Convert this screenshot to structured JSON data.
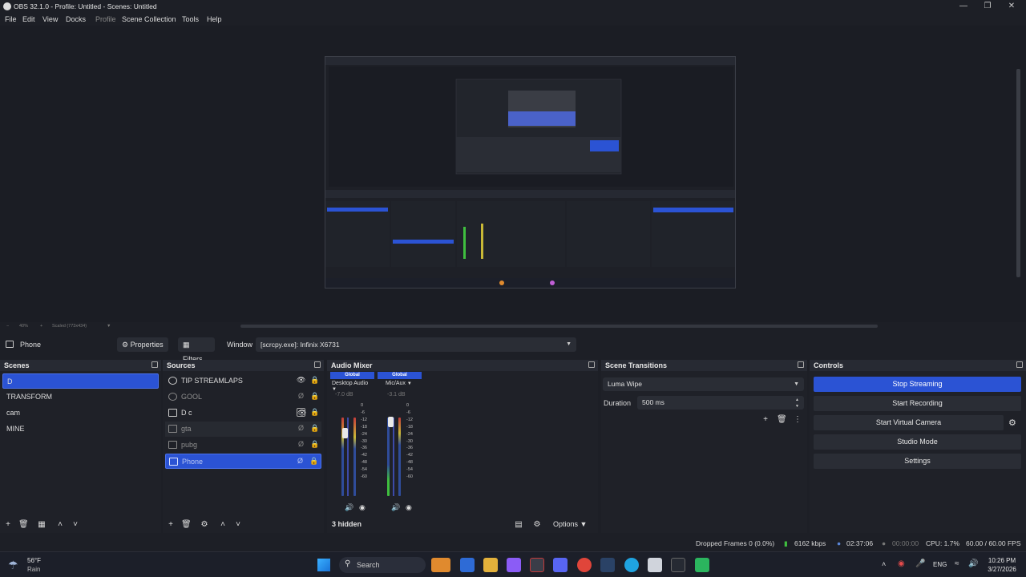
{
  "window": {
    "title": "OBS 32.1.0 - Profile: Untitled - Scenes: Untitled",
    "controls": [
      "minimize",
      "restore",
      "close"
    ]
  },
  "menu": {
    "file": "File",
    "edit": "Edit",
    "view": "View",
    "docks": "Docks",
    "profile": "Profile",
    "scene_collection": "Scene Collection",
    "tools": "Tools",
    "help": "Help"
  },
  "preview": {
    "zoom": "40%",
    "scaled": "Scaled (773x434)"
  },
  "context_bar": {
    "source_name": "Phone",
    "properties_label": "Properties",
    "filters_label": "Filters",
    "window_label": "Window",
    "window_value": "[scrcpy.exe]: Infinix X6731"
  },
  "scenes": {
    "title": "Scenes",
    "items": [
      "D",
      "TRANSFORM",
      "cam",
      "MINE"
    ],
    "selected": "D"
  },
  "sources": {
    "title": "Sources",
    "items": [
      {
        "name": "TIP STREAMLAPS",
        "icon": "browser-icon",
        "visible": true
      },
      {
        "name": "GOOL",
        "icon": "browser-icon",
        "visible": false
      },
      {
        "name": "D c",
        "icon": "window-icon",
        "visible": true
      },
      {
        "name": "gta",
        "icon": "window-icon",
        "visible": false
      },
      {
        "name": "pubg",
        "icon": "window-icon",
        "visible": false
      },
      {
        "name": "Phone",
        "icon": "window-icon",
        "visible": false,
        "selected": true
      }
    ]
  },
  "audio_mixer": {
    "title": "Audio Mixer",
    "channels": [
      {
        "global": "Global",
        "name": "Desktop Audio",
        "db": "-7.0 dB"
      },
      {
        "global": "Global",
        "name": "Mic/Aux",
        "db": "-3.1 dB"
      }
    ],
    "scale": [
      "0",
      "-6",
      "-12",
      "-18",
      "-24",
      "-30",
      "-36",
      "-42",
      "-48",
      "-54",
      "-60"
    ],
    "hidden": "3 hidden",
    "options": "Options"
  },
  "scene_transitions": {
    "title": "Scene Transitions",
    "transition": "Luma Wipe",
    "duration_label": "Duration",
    "duration_value": "500 ms"
  },
  "controls": {
    "title": "Controls",
    "stop_streaming": "Stop Streaming",
    "start_recording": "Start Recording",
    "start_virtual_camera": "Start Virtual Camera",
    "studio_mode": "Studio Mode",
    "settings": "Settings"
  },
  "status": {
    "dropped_frames": "Dropped Frames 0 (0.0%)",
    "bitrate": "6162 kbps",
    "stream_time": "02:37:06",
    "rec_time": "00:00:00",
    "cpu": "CPU: 1.7%",
    "fps": "60.00 / 60.00 FPS"
  },
  "taskbar": {
    "weather_temp": "56°F",
    "weather_desc": "Rain",
    "search": "Search",
    "lang": "ENG",
    "time": "10:26 PM",
    "date": "3/27/2026"
  },
  "colors": {
    "accent": "#2b53d4",
    "background": "#1d1f26",
    "panel": "#1f2128",
    "meter_green": "#3fbf3f",
    "meter_yellow": "#c8b836",
    "meter_red": "#c43a3a"
  }
}
